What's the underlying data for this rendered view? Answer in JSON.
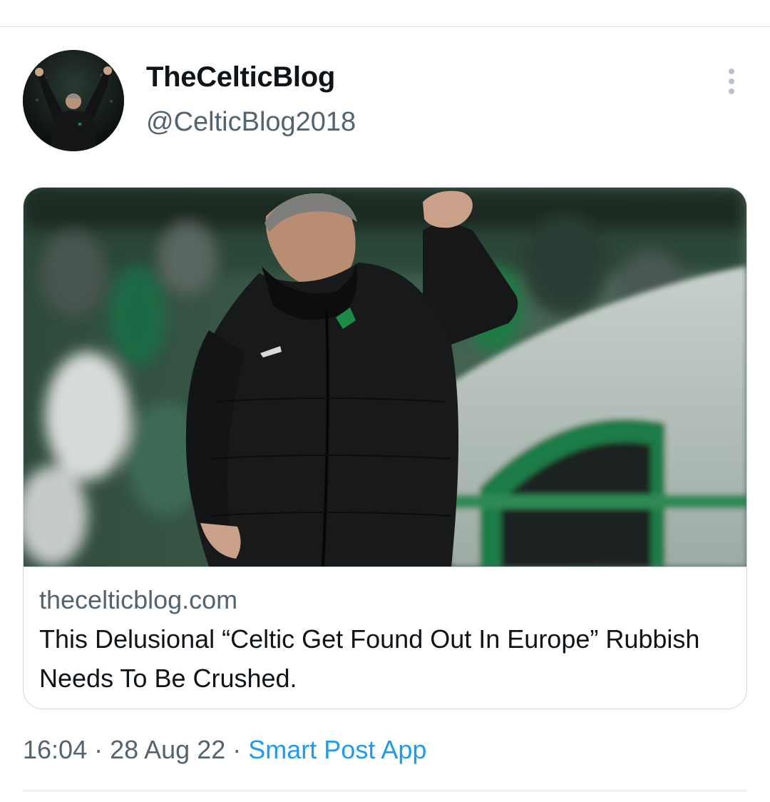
{
  "tweet": {
    "author": {
      "display_name": "TheCelticBlog",
      "handle": "@CelticBlog2018",
      "avatar_icon": "profile-photo"
    },
    "more_icon": "more-vertical-icon",
    "card": {
      "image_description": "celtic-manager-fist-pump-photo",
      "domain": "thecelticblog.com",
      "title": "This Delusional “Celtic Get Found Out In Europe” Rubbish Needs To Be Crushed."
    },
    "meta": {
      "time": "16:04",
      "separator": "·",
      "date": "28 Aug 22",
      "source": "Smart Post App"
    }
  },
  "colors": {
    "text_primary": "#0f1419",
    "text_secondary": "#536471",
    "link": "#1d9bf0",
    "border": "#cfd9de"
  }
}
